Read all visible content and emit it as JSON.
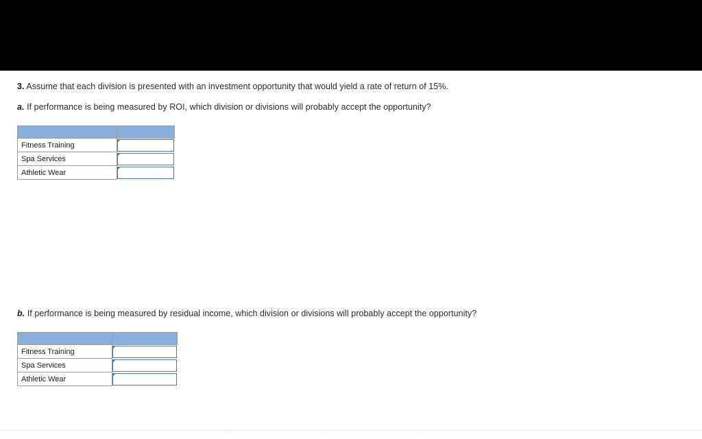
{
  "document": {
    "question_number_label": "3.",
    "question_text": "Assume that each division is presented with an investment opportunity that would yield a rate of return of 15%.",
    "parts": [
      {
        "marker": "a.",
        "text": "If performance is being measured by ROI, which division or divisions will probably accept the opportunity?"
      },
      {
        "marker": "b.",
        "text": "If performance is being measured by residual income, which division or divisions will probably accept the opportunity?"
      }
    ]
  },
  "tables": {
    "roi": {
      "header": [
        "",
        ""
      ],
      "rows": [
        {
          "label": "Fitness Training",
          "answer": ""
        },
        {
          "label": "Spa Services",
          "answer": ""
        },
        {
          "label": "Athletic Wear",
          "answer": ""
        }
      ]
    },
    "residual_income": {
      "header": [
        "",
        ""
      ],
      "rows": [
        {
          "label": "Fitness Training",
          "answer": ""
        },
        {
          "label": "Spa Services",
          "answer": ""
        },
        {
          "label": "Athletic Wear",
          "answer": ""
        }
      ]
    }
  },
  "colors": {
    "header_blue": "#8aafdd",
    "input_border_blue": "#4a76ad",
    "cell_border_gray": "#9a9a9a",
    "text": "#2b2b2b",
    "letterbox": "#000000"
  }
}
